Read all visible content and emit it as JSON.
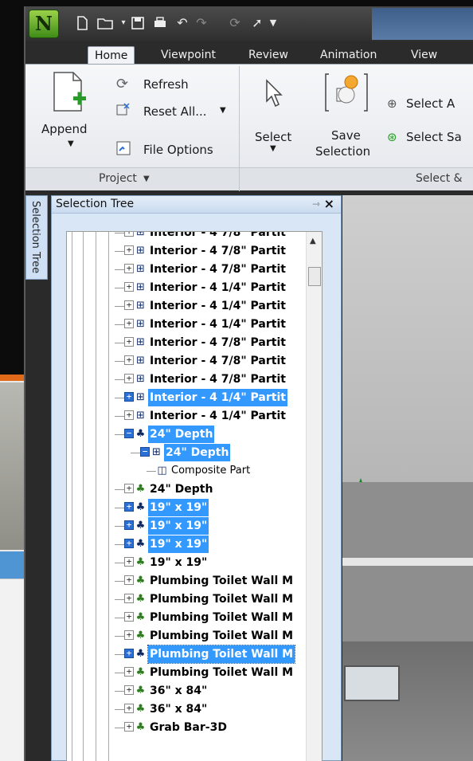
{
  "app": {
    "logo_letter": "N",
    "colors": {
      "accent": "#3399ff",
      "title_bar": "#3a3a3a",
      "ribbon": "#eef0f3",
      "logo_green": "#5fb02a"
    }
  },
  "quick_access": {
    "icons": [
      "new-file-icon",
      "open-folder-icon",
      "save-icon",
      "print-icon",
      "undo-icon",
      "redo-icon",
      "refresh-icon",
      "select-cursor-icon",
      "customize-dropdown-icon"
    ]
  },
  "tabs": [
    {
      "label": "Home",
      "active": true
    },
    {
      "label": "Viewpoint"
    },
    {
      "label": "Review"
    },
    {
      "label": "Animation"
    },
    {
      "label": "View"
    }
  ],
  "ribbon": {
    "project": {
      "append_label": "Append",
      "refresh_label": "Refresh",
      "reset_all_label": "Reset All...",
      "file_options_label": "File Options",
      "group_label": "Project"
    },
    "select": {
      "select_label": "Select",
      "save_label": "Save",
      "selection_label": "Selection",
      "select_a_label": "Select A",
      "select_sa_label": "Select Sa",
      "group_label": "Select &"
    }
  },
  "side_tab": {
    "label": "Selection Tree"
  },
  "panel": {
    "title": "Selection Tree",
    "tree": [
      {
        "label": "Interior - 4 7/8\" Partit",
        "icon": "box-group-icon",
        "selected": false
      },
      {
        "label": "Interior - 4 7/8\" Partit",
        "icon": "box-group-icon",
        "selected": false
      },
      {
        "label": "Interior - 4 7/8\" Partit",
        "icon": "box-group-icon",
        "selected": false
      },
      {
        "label": "Interior - 4 1/4\" Partit",
        "icon": "box-group-icon",
        "selected": false
      },
      {
        "label": "Interior - 4 1/4\" Partit",
        "icon": "box-group-icon",
        "selected": false
      },
      {
        "label": "Interior - 4 1/4\" Partit",
        "icon": "box-group-icon",
        "selected": false
      },
      {
        "label": "Interior - 4 7/8\" Partit",
        "icon": "box-group-icon",
        "selected": false
      },
      {
        "label": "Interior - 4 7/8\" Partit",
        "icon": "box-group-icon",
        "selected": false
      },
      {
        "label": "Interior - 4 7/8\" Partit",
        "icon": "box-group-icon",
        "selected": false
      },
      {
        "label": "Interior - 4 1/4\" Partit",
        "icon": "box-group-icon",
        "selected": true
      },
      {
        "label": "Interior - 4 1/4\" Partit",
        "icon": "box-group-icon",
        "selected": false
      },
      {
        "label": "24\" Depth",
        "icon": "layer-icon",
        "selected": true
      },
      {
        "label": "24\" Depth",
        "icon": "box-group-icon",
        "selected": true
      },
      {
        "label": "Composite Part",
        "icon": "composite-part-icon",
        "selected": false
      },
      {
        "label": "24\" Depth",
        "icon": "layer-icon",
        "selected": false
      },
      {
        "label": "19\" x 19\"",
        "icon": "layer-icon",
        "selected": true
      },
      {
        "label": "19\" x 19\"",
        "icon": "layer-icon",
        "selected": true
      },
      {
        "label": "19\" x 19\"",
        "icon": "layer-icon",
        "selected": true
      },
      {
        "label": "19\" x 19\"",
        "icon": "layer-icon",
        "selected": false
      },
      {
        "label": "Plumbing Toilet Wall M",
        "icon": "layer-icon",
        "selected": false
      },
      {
        "label": "Plumbing Toilet Wall M",
        "icon": "layer-icon",
        "selected": false
      },
      {
        "label": "Plumbing Toilet Wall M",
        "icon": "layer-icon",
        "selected": false
      },
      {
        "label": "Plumbing Toilet Wall M",
        "icon": "layer-icon",
        "selected": false
      },
      {
        "label": "Plumbing Toilet Wall M",
        "icon": "layer-icon",
        "selected": true
      },
      {
        "label": "Plumbing Toilet Wall M",
        "icon": "layer-icon",
        "selected": false
      },
      {
        "label": "36\" x 84\"",
        "icon": "layer-icon",
        "selected": false
      },
      {
        "label": "36\" x 84\"",
        "icon": "layer-icon",
        "selected": false
      },
      {
        "label": "Grab Bar-3D",
        "icon": "layer-icon",
        "selected": false
      }
    ]
  }
}
